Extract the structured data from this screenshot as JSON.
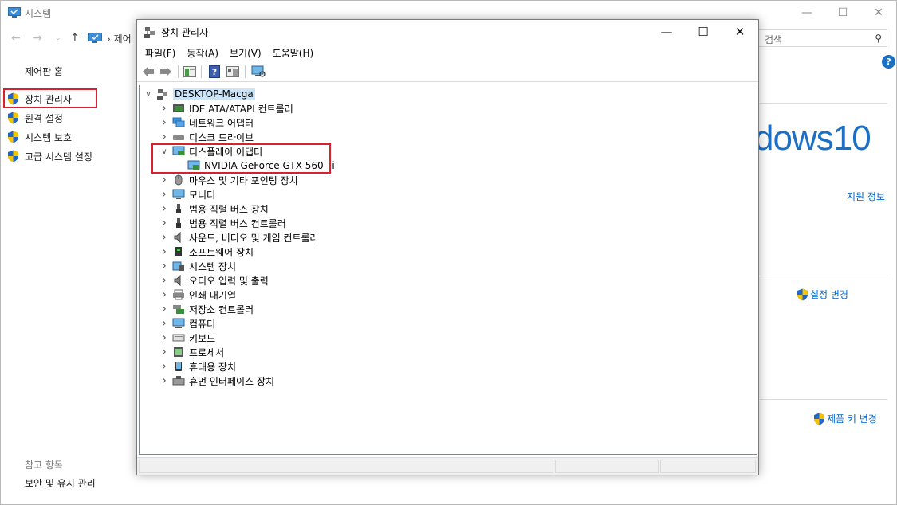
{
  "system_window": {
    "title": "시스템",
    "address": "제어",
    "search_placeholder": "검색",
    "left_panel": {
      "home": "제어판 홈",
      "links": [
        "장치 관리자",
        "원격 설정",
        "시스템 보호",
        "고급 시스템 설정"
      ],
      "see_also": "참고 항목",
      "security": "보안 및 유지 관리"
    },
    "brand": "dows10",
    "support_info": "지원 정보",
    "change_settings": "설정 변경",
    "change_product_key": "제품 키 변경"
  },
  "device_manager": {
    "title": "장치 관리자",
    "menu": [
      "파일(F)",
      "동작(A)",
      "보기(V)",
      "도움말(H)"
    ],
    "root": "DESKTOP-Macga",
    "categories": [
      {
        "label": "IDE ATA/ATAPI 컨트롤러",
        "icon": "ide-icon"
      },
      {
        "label": "네트워크 어댑터",
        "icon": "network-icon"
      },
      {
        "label": "디스크 드라이브",
        "icon": "disk-icon"
      },
      {
        "label": "디스플레이 어댑터",
        "icon": "display-adapter-icon",
        "expanded": true,
        "children": [
          "NVIDIA GeForce GTX 560 Ti"
        ]
      },
      {
        "label": "마우스 및 기타 포인팅 장치",
        "icon": "mouse-icon"
      },
      {
        "label": "모니터",
        "icon": "monitor-icon"
      },
      {
        "label": "범용 직렬 버스 장치",
        "icon": "usb-icon"
      },
      {
        "label": "범용 직렬 버스 컨트롤러",
        "icon": "usb-icon"
      },
      {
        "label": "사운드, 비디오 및 게임 컨트롤러",
        "icon": "speaker-icon"
      },
      {
        "label": "소프트웨어 장치",
        "icon": "software-device-icon"
      },
      {
        "label": "시스템 장치",
        "icon": "system-device-icon"
      },
      {
        "label": "오디오 입력 및 출력",
        "icon": "speaker-icon"
      },
      {
        "label": "인쇄 대기열",
        "icon": "printer-icon"
      },
      {
        "label": "저장소 컨트롤러",
        "icon": "storage-controller-icon"
      },
      {
        "label": "컴퓨터",
        "icon": "computer-icon"
      },
      {
        "label": "키보드",
        "icon": "keyboard-icon"
      },
      {
        "label": "프로세서",
        "icon": "processor-icon"
      },
      {
        "label": "휴대용 장치",
        "icon": "portable-device-icon"
      },
      {
        "label": "휴먼 인터페이스 장치",
        "icon": "hid-icon"
      }
    ]
  },
  "colors": {
    "highlight": "#d9202b",
    "link": "#0066cc",
    "brand": "#1d6fc5",
    "selection": "#cce4f7"
  }
}
